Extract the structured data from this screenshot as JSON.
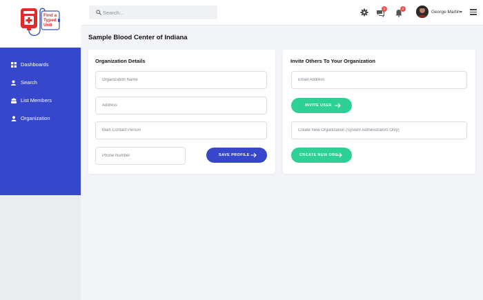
{
  "brand": {
    "logo_text": "Find a Typed Unit",
    "logo_color": "#e02b2b"
  },
  "sidebar": {
    "items": [
      {
        "label": "Dashboards",
        "icon": "grid-icon"
      },
      {
        "label": "Search",
        "icon": "search-user-icon"
      },
      {
        "label": "List Members",
        "icon": "users-icon"
      },
      {
        "label": "Organization",
        "icon": "user-icon"
      }
    ],
    "accent": "#3647cc"
  },
  "topbar": {
    "search_placeholder": "Search...",
    "icons": [
      "gear-icon",
      "chat-icon",
      "bell-icon",
      "menu-icon"
    ],
    "chat_badge": "3",
    "bell_badge": "4",
    "badge_color": "#f0524f",
    "user_name": "George Martin"
  },
  "main": {
    "page_title": "Sample Blood Center of Indiana",
    "org_card": {
      "title": "Organization Details",
      "org_name_placeholder": "Organization Name",
      "address_placeholder": "Address",
      "contact_placeholder": "Main Contact Person",
      "phone_placeholder": "Phone Number",
      "save_label": "SAVE PROFILE"
    },
    "invite_card": {
      "title": "Invite Others To Your Organization",
      "email_placeholder": "Email Address",
      "invite_label": "INVITE USER",
      "new_org_placeholder": "Create New Organization (System Administrators Only)",
      "create_label": "CREATE NEW ORG"
    }
  },
  "colors": {
    "primary_blue": "#3647cc",
    "success_green": "#2dd095",
    "page_bg": "#f3f5f9"
  }
}
